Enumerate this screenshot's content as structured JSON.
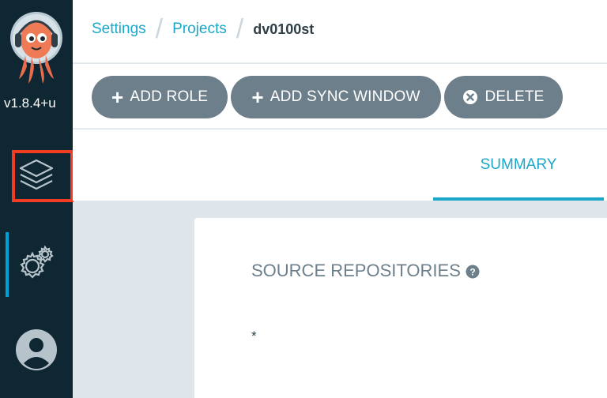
{
  "sidebar": {
    "version": "v1.8.4+u",
    "nav": {
      "applications_icon": "layers-icon",
      "settings_icon": "gears-icon",
      "user_icon": "user-icon"
    },
    "logo_icon": "octopus-logo"
  },
  "breadcrumb": {
    "items": [
      "Settings",
      "Projects"
    ],
    "current": "dv0100st"
  },
  "toolbar": {
    "add_role": "ADD ROLE",
    "add_sync_window": "ADD SYNC WINDOW",
    "delete": "DELETE"
  },
  "tabs": {
    "summary": "SUMMARY"
  },
  "summary": {
    "source_repositories": {
      "title": "SOURCE REPOSITORIES",
      "items": [
        "*"
      ]
    }
  },
  "colors": {
    "sidebar_bg": "#0e2733",
    "accent": "#1ba7c9",
    "button_bg": "#6d7f8b",
    "highlight": "#f23c24"
  }
}
